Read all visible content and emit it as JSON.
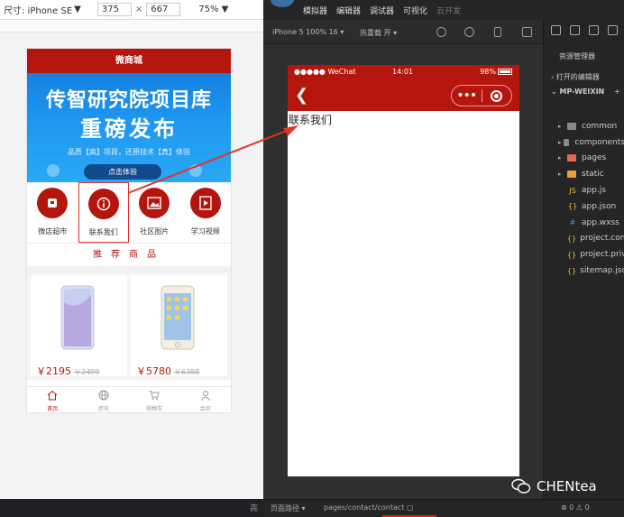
{
  "devtools": {
    "size_label": "尺寸: iPhone SE",
    "width": "375",
    "times": "×",
    "height": "667",
    "zoom": "75%"
  },
  "mall": {
    "title": "微商城",
    "banner": {
      "line1": "传智研究院项目库",
      "line2": "重磅发布",
      "line3": "品质【高】项目，还原技术【真】体验",
      "cta": "点击体验"
    },
    "categories": [
      {
        "label": "微店超市",
        "icon": "shop-icon"
      },
      {
        "label": "联系我们",
        "icon": "info-icon"
      },
      {
        "label": "社区图片",
        "icon": "image-icon"
      },
      {
        "label": "学习视频",
        "icon": "video-icon"
      }
    ],
    "recommend": "推荐商品",
    "goods": [
      {
        "price": "￥2195",
        "old_price": "￥2499"
      },
      {
        "price": "￥5780",
        "old_price": "￥6388"
      }
    ],
    "tabs": [
      {
        "label": "首页",
        "icon": "home-icon"
      },
      {
        "label": "资讯",
        "icon": "globe-icon"
      },
      {
        "label": "购物车",
        "icon": "cart-icon"
      },
      {
        "label": "会员",
        "icon": "user-icon"
      }
    ]
  },
  "wx": {
    "menu": [
      "模拟器",
      "编辑器",
      "调试器",
      "可视化",
      "云开发"
    ],
    "device": "iPhone 5 100% 16 ▾",
    "hotreload": "热重载 开 ▾",
    "status": {
      "signal": "●●●●● WeChat",
      "time": "14:01",
      "battery": "98%"
    },
    "page_text": "联系我们",
    "bottom": {
      "path_label": "页面路径 ▾",
      "path": "pages/contact/contact",
      "errors": "⊗ 0 ⚠ 0"
    }
  },
  "explorer": {
    "title": "资源管理器",
    "open_editors": "打开的编辑器",
    "project": "MP-WEIXIN",
    "items": [
      {
        "name": "common",
        "type": "folder",
        "color": "#8a8a8a"
      },
      {
        "name": "components",
        "type": "folder",
        "color": "#8a8a8a"
      },
      {
        "name": "pages",
        "type": "folder",
        "color": "#e06c4a"
      },
      {
        "name": "static",
        "type": "folder",
        "color": "#e8a13a"
      },
      {
        "name": "app.js",
        "type": "js",
        "color": "#e6c13b"
      },
      {
        "name": "app.json",
        "type": "json",
        "color": "#e6c13b"
      },
      {
        "name": "app.wxss",
        "type": "css",
        "color": "#3b8eea"
      },
      {
        "name": "project.config.json",
        "type": "json",
        "color": "#e6c13b"
      },
      {
        "name": "project.private.config.json",
        "type": "json",
        "color": "#e6c13b"
      },
      {
        "name": "sitemap.json",
        "type": "json",
        "color": "#e6c13b"
      }
    ]
  },
  "watermark": "CHENtea"
}
